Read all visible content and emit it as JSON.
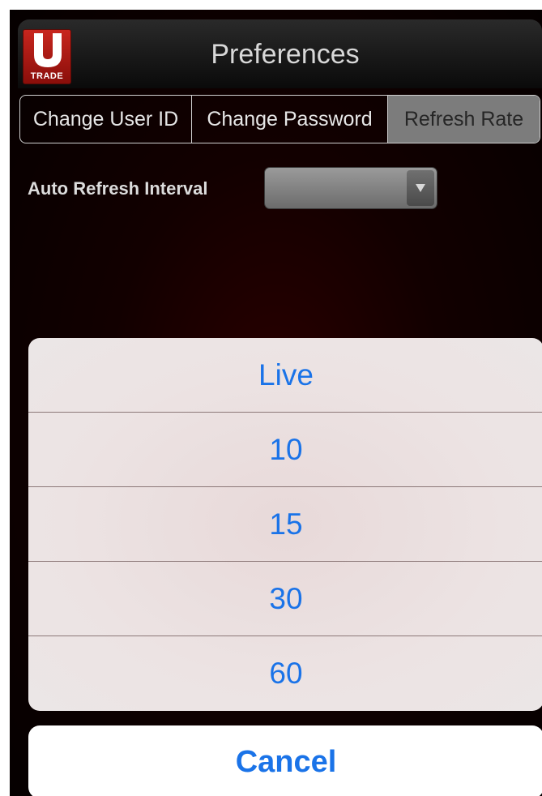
{
  "header": {
    "title": "Preferences",
    "logo": {
      "letter": "U",
      "brand": "TRADE",
      "color": "#c0231b"
    }
  },
  "tabs": [
    {
      "label": "Change User ID",
      "selected": false
    },
    {
      "label": "Change Password",
      "selected": false
    },
    {
      "label": "Refresh Rate",
      "selected": true
    }
  ],
  "refresh": {
    "label": "Auto Refresh Interval",
    "selected_value": ""
  },
  "action_sheet": {
    "options": [
      "Live",
      "10",
      "15",
      "30",
      "60"
    ],
    "cancel_label": "Cancel",
    "accent_color": "#1a73e8"
  }
}
